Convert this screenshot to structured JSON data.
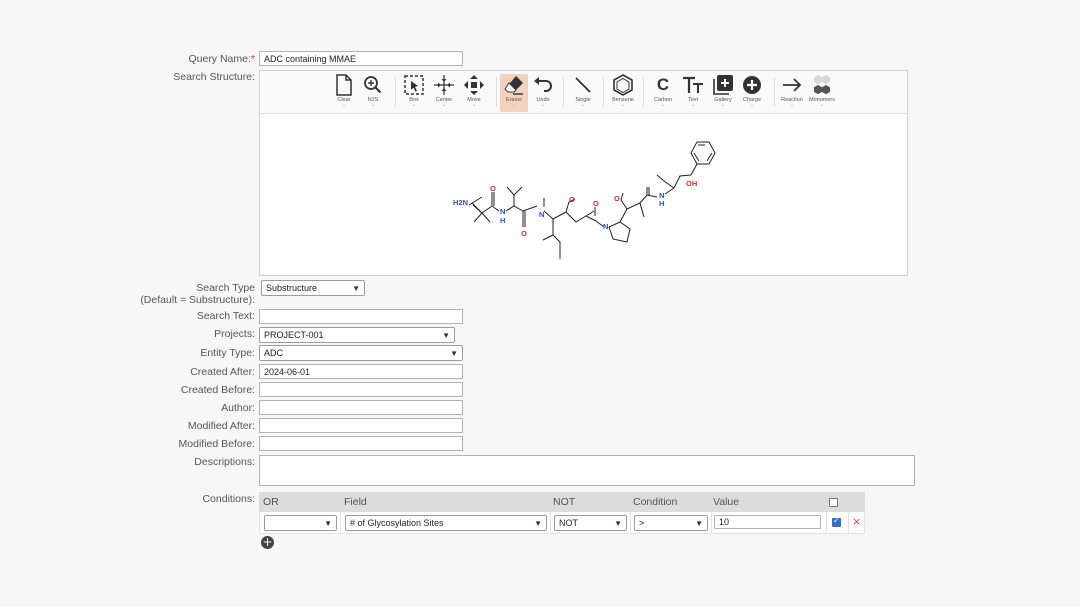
{
  "form": {
    "query_name": {
      "label": "Query Name:",
      "required_mark": "*",
      "value": "ADC containing MMAE"
    },
    "search_structure": {
      "label": "Search Structure:"
    },
    "search_type": {
      "label_line1": "Search Type",
      "label_line2": "(Default = Substructure):",
      "value": "Substructure"
    },
    "search_text": {
      "label": "Search Text:",
      "value": ""
    },
    "projects": {
      "label": "Projects:",
      "value": "PROJECT-001"
    },
    "entity_type": {
      "label": "Entity Type:",
      "value": "ADC"
    },
    "created_after": {
      "label": "Created After:",
      "value": "2024-06-01"
    },
    "created_before": {
      "label": "Created Before:",
      "value": ""
    },
    "author": {
      "label": "Author:",
      "value": ""
    },
    "modified_after": {
      "label": "Modified After:",
      "value": ""
    },
    "modified_before": {
      "label": "Modified Before:",
      "value": ""
    },
    "descriptions": {
      "label": "Descriptions:",
      "value": ""
    },
    "conditions": {
      "label": "Conditions:"
    }
  },
  "toolbar": {
    "tools": [
      {
        "label": "Clear",
        "icon": "file-icon"
      },
      {
        "label": "N2S",
        "icon": "zoom-icon"
      },
      {
        "label": "Box",
        "icon": "box-select-icon"
      },
      {
        "label": "Center",
        "icon": "center-icon"
      },
      {
        "label": "Move",
        "icon": "move-icon"
      },
      {
        "label": "Eraser",
        "icon": "eraser-icon"
      },
      {
        "label": "Undo",
        "icon": "undo-icon"
      },
      {
        "label": "Single",
        "icon": "single-bond-icon"
      },
      {
        "label": "Benzene",
        "icon": "benzene-icon"
      },
      {
        "label": "Carbon",
        "icon": "carbon-icon",
        "glyph": "C"
      },
      {
        "label": "Text",
        "icon": "text-icon",
        "glyph": "TT"
      },
      {
        "label": "Gallery",
        "icon": "gallery-icon"
      },
      {
        "label": "Charge",
        "icon": "charge-icon"
      },
      {
        "label": "Reaction",
        "icon": "reaction-arrow-icon"
      },
      {
        "label": "Monomers",
        "icon": "monomers-icon"
      }
    ]
  },
  "molecule": {
    "atoms": {
      "nh2": "H2N",
      "nh1": "N",
      "h1": "H",
      "n2": "N",
      "n3": "N",
      "nh4": "N",
      "h4": "H",
      "o1": "O",
      "o2": "O",
      "o3": "O",
      "o4": "O",
      "o5": "O",
      "oh": "OH"
    },
    "colors": {
      "nitrogen": "#2b4fc5",
      "oxygen": "#d42a2a",
      "carbon": "#222222"
    }
  },
  "conditions_table": {
    "headers": {
      "or": "OR",
      "field": "Field",
      "not": "NOT",
      "condition": "Condition",
      "value": "Value"
    },
    "row": {
      "or": "",
      "field": "# of Glycosylation Sites",
      "not": "NOT",
      "condition": ">",
      "value": "10",
      "checked": true,
      "delete_icon": "×"
    },
    "add_button": "+"
  }
}
